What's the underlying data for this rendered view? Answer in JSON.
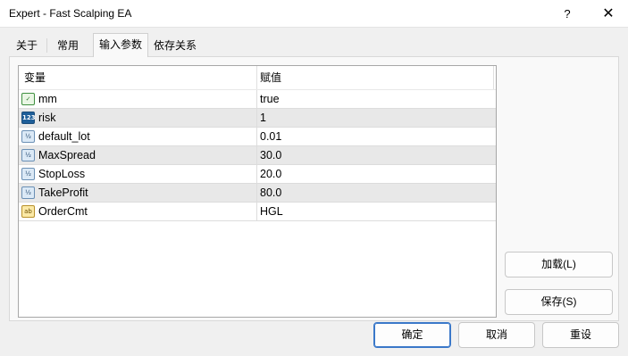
{
  "window": {
    "title": "Expert - Fast Scalping EA",
    "help_label": "?",
    "close_label": "✕"
  },
  "tabs": [
    "关于",
    "常用",
    "输入参数",
    "依存关系"
  ],
  "table": {
    "headers": [
      "变量",
      "赋值"
    ],
    "rows": [
      {
        "icon": "bool-icon",
        "name": "mm",
        "value": "true"
      },
      {
        "icon": "int-icon",
        "name": "risk",
        "value": "1"
      },
      {
        "icon": "double-icon",
        "name": "default_lot",
        "value": "0.01"
      },
      {
        "icon": "double-icon",
        "name": "MaxSpread",
        "value": "30.0"
      },
      {
        "icon": "double-icon",
        "name": "StopLoss",
        "value": "20.0"
      },
      {
        "icon": "double-icon",
        "name": "TakeProfit",
        "value": "80.0"
      },
      {
        "icon": "string-icon",
        "name": "OrderCmt",
        "value": "HGL"
      }
    ]
  },
  "buttons": {
    "load": "加载(L)",
    "save": "保存(S)",
    "ok": "确定",
    "cancel": "取消",
    "reset": "重设"
  },
  "colors": {
    "accent": "#3a78c9",
    "alt_row": "#e8e8e8"
  }
}
